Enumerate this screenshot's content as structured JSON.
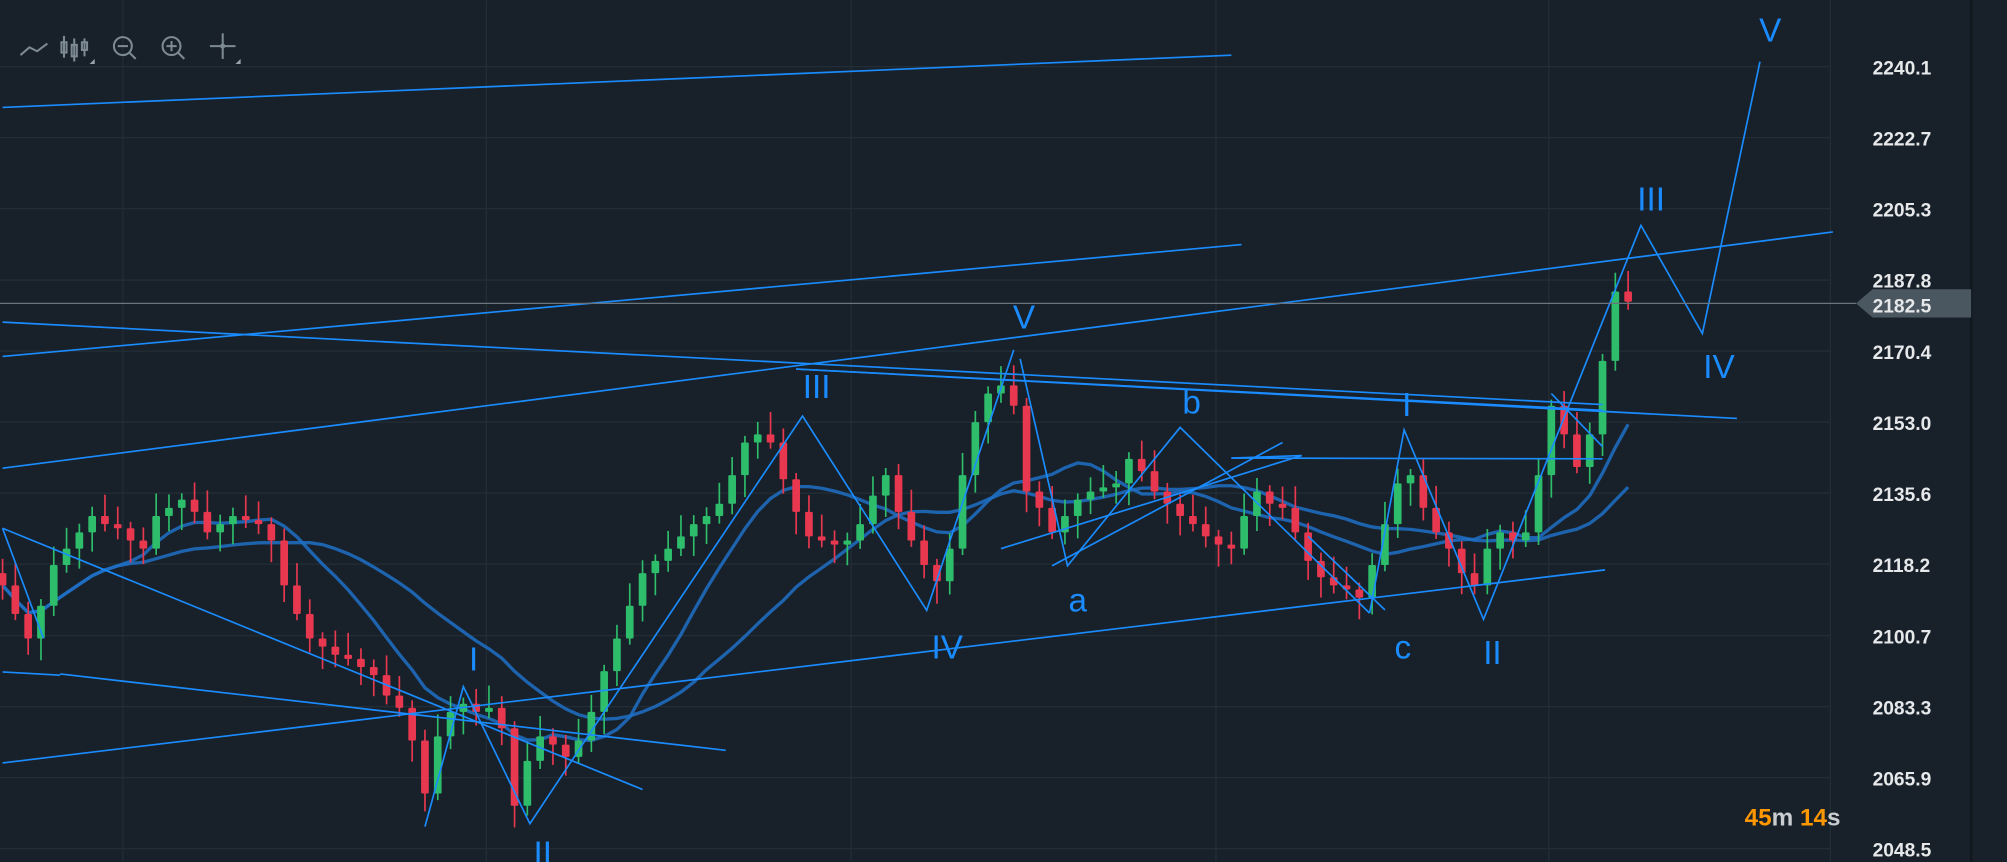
{
  "toolbar": {
    "items": [
      {
        "name": "line-chart-icon"
      },
      {
        "name": "candlestick-chart-icon"
      },
      {
        "name": "zoom-out-icon"
      },
      {
        "name": "zoom-in-icon"
      },
      {
        "name": "pan-move-icon"
      }
    ]
  },
  "timer": {
    "minutes": "45",
    "m": "m",
    "seconds": "14",
    "s": "s"
  },
  "colors": {
    "background": "#18212a",
    "up": "#2ebd6b",
    "down": "#e8384f",
    "drawing": "#1a8cff",
    "ma": "#1f6fc4",
    "timer": "#ff9800"
  },
  "chart_data": {
    "type": "candlestick",
    "y_ticks": [
      "2240.1",
      "2222.7",
      "2205.3",
      "2187.8",
      "2170.4",
      "2153.0",
      "2135.6",
      "2118.2",
      "2100.7",
      "2083.3",
      "2065.9",
      "2048.5"
    ],
    "ylim": [
      2048.5,
      2240.1
    ],
    "current_price": "2182.5",
    "closes": [
      2113,
      2106,
      2100,
      2108,
      2118,
      2122,
      2126,
      2130,
      2128,
      2127,
      2124,
      2122,
      2130,
      2132,
      2134,
      2131,
      2126,
      2128,
      2130,
      2129,
      2128,
      2124,
      2113,
      2106,
      2100,
      2098,
      2096,
      2095,
      2093,
      2091,
      2086,
      2083,
      2075,
      2062,
      2076,
      2082,
      2084,
      2082,
      2083,
      2078,
      2059,
      2070,
      2076,
      2074,
      2071,
      2075,
      2082,
      2092,
      2100,
      2108,
      2116,
      2119,
      2122,
      2125,
      2128,
      2130,
      2133,
      2140,
      2148,
      2150,
      2148,
      2139,
      2131,
      2125,
      2124,
      2123,
      2124,
      2128,
      2135,
      2140,
      2131,
      2124,
      2118,
      2114,
      2122,
      2140,
      2153,
      2160,
      2162,
      2157,
      2136,
      2132,
      2126,
      2130,
      2134,
      2136,
      2137,
      2138,
      2144,
      2141,
      2136,
      2133,
      2130,
      2128,
      2125,
      2123,
      2122,
      2130,
      2136,
      2133,
      2132,
      2126,
      2119,
      2115,
      2113,
      2112,
      2110,
      2118,
      2128,
      2138,
      2140,
      2132,
      2126,
      2122,
      2116,
      2113,
      2122,
      2126,
      2124,
      2126,
      2140,
      2157,
      2150,
      2142,
      2150,
      2168,
      2185,
      2182.5
    ],
    "moving_averages": [
      {
        "period": 10
      },
      {
        "period": 22
      }
    ],
    "trendlines": [
      [
        [
          0,
          2230.1
        ],
        [
          96,
          2242.9
        ]
      ],
      [
        [
          0,
          2169.1
        ],
        [
          96.8,
          2196.5
        ]
      ],
      [
        [
          0,
          2141.7
        ],
        [
          143,
          2199.6
        ]
      ],
      [
        [
          0,
          2177.5
        ],
        [
          125,
          2157.3
        ]
      ],
      [
        [
          62,
          2166.0
        ],
        [
          125,
          2155.9
        ]
      ],
      [
        [
          62,
          2166.0
        ],
        [
          135.5,
          2153.9
        ]
      ],
      [
        [
          0,
          2069.5
        ],
        [
          125.2,
          2116.8
        ]
      ],
      [
        [
          96,
          2144.2
        ],
        [
          101.5,
          2144.8
        ]
      ],
      [
        [
          96,
          2144.2
        ],
        [
          125,
          2144.0
        ]
      ],
      [
        [
          0,
          2127.0
        ],
        [
          50,
          2063.0
        ]
      ],
      [
        [
          4.5,
          2091.3
        ],
        [
          56.5,
          2072.6
        ]
      ],
      [
        [
          0,
          2091.8
        ],
        [
          4.5,
          2091.0
        ]
      ],
      [
        [
          0,
          2127.0
        ],
        [
          3.2,
          2100.0
        ]
      ],
      [
        [
          78,
          2122.0
        ],
        [
          101.5,
          2144.8
        ]
      ],
      [
        [
          82,
          2117.8
        ],
        [
          100,
          2148.0
        ]
      ],
      [
        [
          102,
          2125.0
        ],
        [
          108,
          2107.0
        ]
      ],
      [
        [
          121,
          2160.0
        ],
        [
          125,
          2147.0
        ]
      ]
    ],
    "wave_paths": [
      [
        [
          33,
          2053.9
        ],
        [
          36,
          2088.2
        ],
        [
          41.2,
          2054.6
        ],
        [
          46,
          2077.3
        ],
        [
          62.5,
          2154.5
        ],
        [
          72.2,
          2106.9
        ],
        [
          79,
          2170.7
        ]
      ],
      [
        [
          79.5,
          2168.5
        ],
        [
          83.2,
          2117.8
        ],
        [
          92,
          2151.7
        ],
        [
          106.8,
          2106.2
        ]
      ],
      [
        [
          106.8,
          2106.2
        ],
        [
          109.5,
          2151.1
        ],
        [
          115.7,
          2104.7
        ],
        [
          128,
          2201.2
        ],
        [
          132.8,
          2174.7
        ],
        [
          137.3,
          2241.3
        ]
      ]
    ],
    "wave_labels": [
      {
        "text": "I",
        "at": [
          36.8,
          2095.3
        ]
      },
      {
        "text": "II",
        "at": [
          42.2,
          2047.7
        ]
      },
      {
        "text": "III",
        "at": [
          63.6,
          2162.0
        ]
      },
      {
        "text": "IV",
        "at": [
          73.8,
          2098.2
        ]
      },
      {
        "text": "V",
        "at": [
          79.8,
          2179.1
        ]
      },
      {
        "text": "a",
        "at": [
          84.0,
          2109.7
        ]
      },
      {
        "text": "b",
        "at": [
          92.9,
          2158.2
        ]
      },
      {
        "text": "c",
        "at": [
          109.4,
          2098.2
        ]
      },
      {
        "text": "I",
        "at": [
          109.7,
          2157.6
        ]
      },
      {
        "text": "II",
        "at": [
          116.4,
          2096.9
        ]
      },
      {
        "text": "III",
        "at": [
          128.8,
          2208.0
        ]
      },
      {
        "text": "IV",
        "at": [
          134.1,
          2166.9
        ]
      },
      {
        "text": "V",
        "at": [
          138.1,
          2249.4
        ]
      }
    ]
  }
}
